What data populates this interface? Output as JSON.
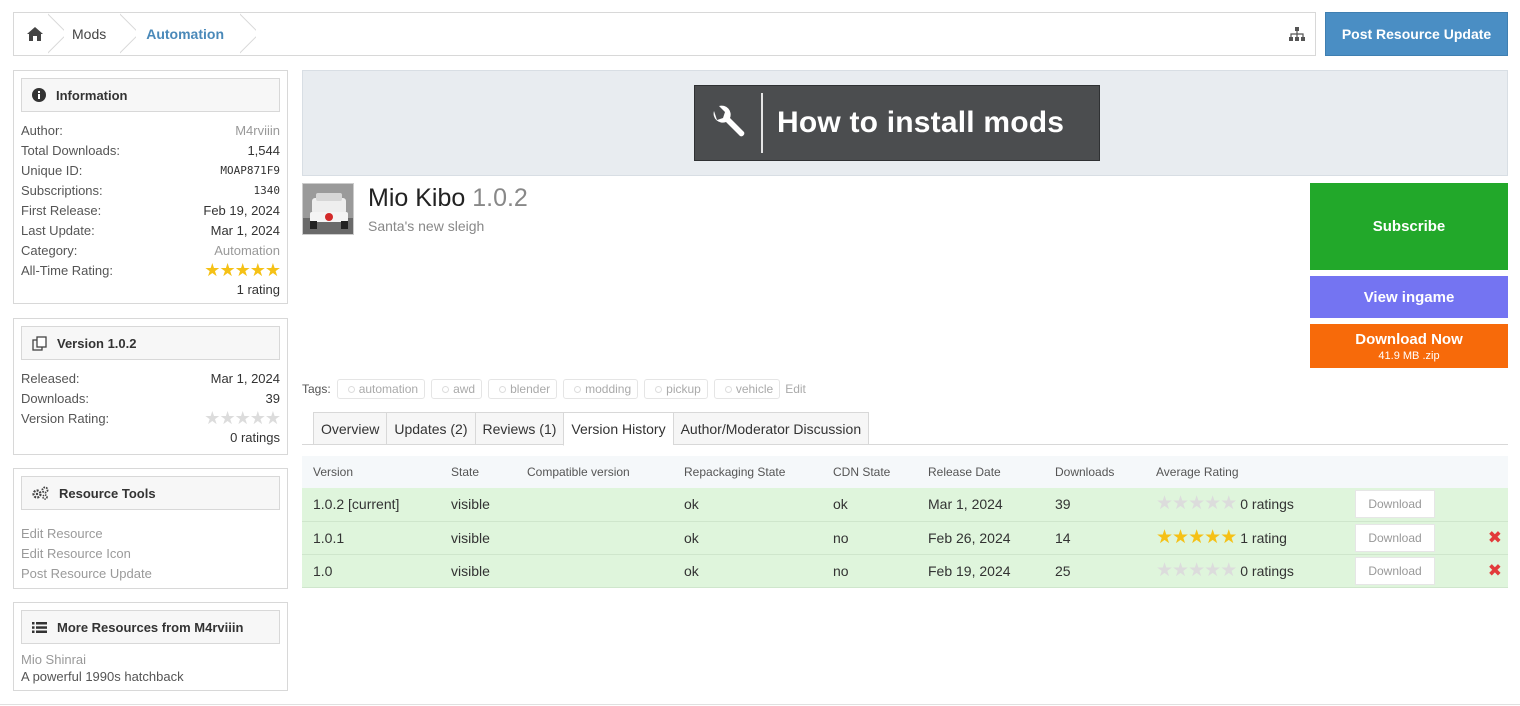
{
  "breadcrumb": {
    "items": [
      "Mods",
      "Automation"
    ]
  },
  "header": {
    "post_update_label": "Post Resource Update"
  },
  "info": {
    "title": "Information",
    "author_label": "Author:",
    "author": "M4rviiin",
    "downloads_label": "Total Downloads:",
    "downloads": "1,544",
    "uid_label": "Unique ID:",
    "uid": "MOAP871F9",
    "subs_label": "Subscriptions:",
    "subs": "1340",
    "first_label": "First Release:",
    "first": "Feb 19, 2024",
    "last_label": "Last Update:",
    "last": "Mar 1, 2024",
    "category_label": "Category:",
    "category": "Automation",
    "rating_label": "All-Time Rating:",
    "rating_stars": 5,
    "rating_count": "1 rating"
  },
  "version": {
    "title": "Version 1.0.2",
    "released_label": "Released:",
    "released": "Mar 1, 2024",
    "downloads_label": "Downloads:",
    "downloads": "39",
    "rating_label": "Version Rating:",
    "rating_stars": 0,
    "rating_count": "0 ratings"
  },
  "tools": {
    "title": "Resource Tools",
    "links": [
      "Edit Resource",
      "Edit Resource Icon",
      "Post Resource Update"
    ]
  },
  "more": {
    "title": "More Resources from M4rviiin",
    "item_title": "Mio Shinrai",
    "item_desc": "A powerful 1990s hatchback"
  },
  "banner": {
    "text": "How to install mods"
  },
  "resource": {
    "name": "Mio Kibo",
    "version": "1.0.2",
    "tagline": "Santa's new sleigh"
  },
  "actions": {
    "subscribe": "Subscribe",
    "view_ingame": "View ingame",
    "download_now": "Download Now",
    "download_meta": "41.9 MB .zip"
  },
  "tags": {
    "label": "Tags:",
    "items": [
      "automation",
      "awd",
      "blender",
      "modding",
      "pickup",
      "vehicle"
    ],
    "edit": "Edit"
  },
  "tabs": [
    "Overview",
    "Updates (2)",
    "Reviews (1)",
    "Version History",
    "Author/Moderator Discussion"
  ],
  "table": {
    "headers": [
      "Version",
      "State",
      "Compatible version",
      "Repackaging State",
      "CDN State",
      "Release Date",
      "Downloads",
      "Average Rating"
    ],
    "download_label": "Download",
    "rows": [
      {
        "version": "1.0.2 [current]",
        "state": "visible",
        "compat": "",
        "repack": "ok",
        "cdn": "ok",
        "date": "Mar 1, 2024",
        "downloads": "39",
        "stars": 0,
        "rating": "0 ratings",
        "deletable": false
      },
      {
        "version": "1.0.1",
        "state": "visible",
        "compat": "",
        "repack": "ok",
        "cdn": "no",
        "date": "Feb 26, 2024",
        "downloads": "14",
        "stars": 5,
        "rating": "1 rating",
        "deletable": true
      },
      {
        "version": "1.0",
        "state": "visible",
        "compat": "",
        "repack": "ok",
        "cdn": "no",
        "date": "Feb 19, 2024",
        "downloads": "25",
        "stars": 0,
        "rating": "0 ratings",
        "deletable": true
      }
    ]
  },
  "colors": {
    "accent": "#4a89b9",
    "subscribe": "#22a82a",
    "view": "#7474f2",
    "download": "#f76a0a",
    "row_bg": "#dff5dc"
  }
}
